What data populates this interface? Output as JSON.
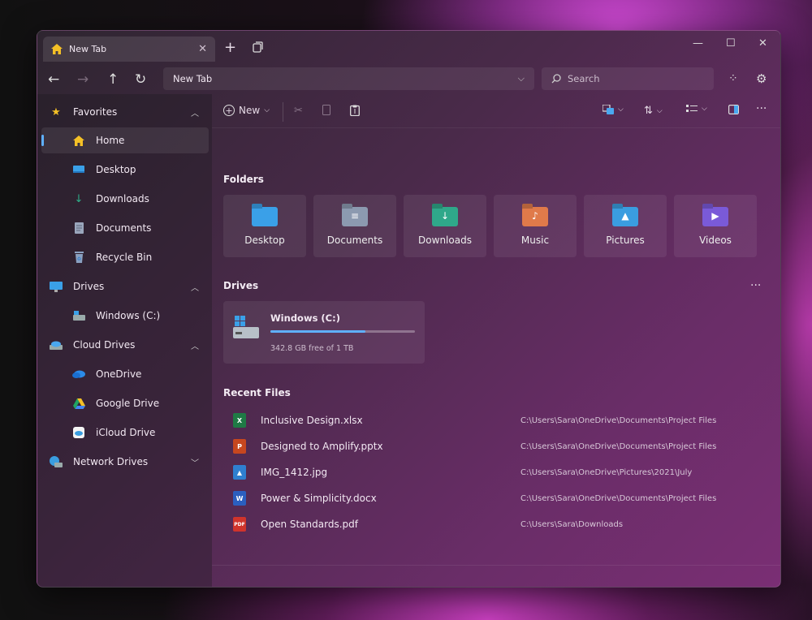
{
  "colors": {
    "accent": "#5fb0ff",
    "home": "#f4c026"
  },
  "tab": {
    "title": "New Tab",
    "icon": "home-icon"
  },
  "address": {
    "value": "New Tab"
  },
  "search": {
    "placeholder": "Search"
  },
  "sidebar": {
    "favorites": {
      "label": "Favorites",
      "items": [
        {
          "label": "Home",
          "icon": "home-icon",
          "active": true
        },
        {
          "label": "Desktop",
          "icon": "desktop-icon"
        },
        {
          "label": "Downloads",
          "icon": "download-icon"
        },
        {
          "label": "Documents",
          "icon": "document-icon"
        },
        {
          "label": "Recycle Bin",
          "icon": "recycle-bin-icon"
        }
      ]
    },
    "drives": {
      "label": "Drives",
      "items": [
        {
          "label": "Windows (C:)",
          "icon": "drive-icon"
        }
      ]
    },
    "cloud": {
      "label": "Cloud Drives",
      "items": [
        {
          "label": "OneDrive",
          "icon": "onedrive-icon"
        },
        {
          "label": "Google Drive",
          "icon": "google-drive-icon"
        },
        {
          "label": "iCloud Drive",
          "icon": "icloud-icon"
        }
      ]
    },
    "network": {
      "label": "Network Drives"
    }
  },
  "toolbar": {
    "new_label": "New"
  },
  "main": {
    "folders_title": "Folders",
    "folders": [
      {
        "label": "Desktop",
        "color": "#3aa0e8",
        "glyph": ""
      },
      {
        "label": "Documents",
        "color": "#8c9ab0",
        "glyph": "≡"
      },
      {
        "label": "Downloads",
        "color": "#2fa88a",
        "glyph": "↓"
      },
      {
        "label": "Music",
        "color": "#e07a4a",
        "glyph": "♪"
      },
      {
        "label": "Pictures",
        "color": "#3a9de0",
        "glyph": "▲"
      },
      {
        "label": "Videos",
        "color": "#7a5ad8",
        "glyph": "▶"
      }
    ],
    "drives_title": "Drives",
    "drive": {
      "name": "Windows (C:)",
      "free": "342.8 GB free of 1 TB",
      "used_fraction": 0.66
    },
    "recent_title": "Recent Files",
    "recent": [
      {
        "name": "Inclusive Design.xlsx",
        "path": "C:\\Users\\Sara\\OneDrive\\Documents\\Project Files",
        "type": "X",
        "color": "#1f7a45"
      },
      {
        "name": "Designed to Amplify.pptx",
        "path": "C:\\Users\\Sara\\OneDrive\\Documents\\Project Files",
        "type": "P",
        "color": "#c6471f"
      },
      {
        "name": "IMG_1412.jpg",
        "path": "C:\\Users\\Sara\\OneDrive\\Pictures\\2021\\July",
        "type": "▲",
        "color": "#2f7fd0"
      },
      {
        "name": "Power & Simplicity.docx",
        "path": "C:\\Users\\Sara\\OneDrive\\Documents\\Project Files",
        "type": "W",
        "color": "#2b5fbf"
      },
      {
        "name": "Open Standards.pdf",
        "path": "C:\\Users\\Sara\\Downloads",
        "type": "PDF",
        "color": "#d0342c"
      }
    ]
  }
}
